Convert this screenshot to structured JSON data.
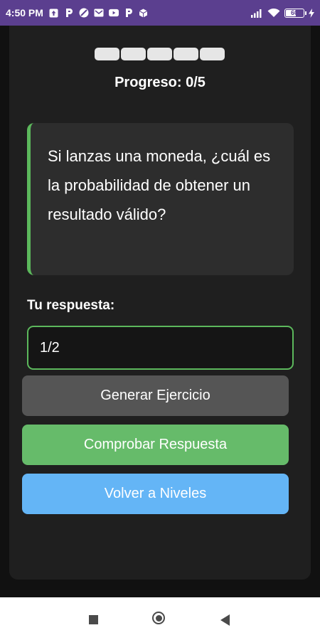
{
  "status_bar": {
    "time": "4:50 PM",
    "battery_level": "60",
    "battery_fraction": 0.6,
    "icons_left": [
      "upload-icon",
      "parking-icon",
      "blocked-icon",
      "mail-icon",
      "youtube-icon",
      "parking-icon",
      "package-icon"
    ],
    "icons_right": [
      "signal-icon",
      "wifi-icon",
      "battery-icon",
      "charging-icon"
    ],
    "color": "#5b3f8f"
  },
  "progress": {
    "label": "Progreso: 0/5",
    "completed": 0,
    "total": 5
  },
  "question": {
    "text": "Si lanzas una moneda, ¿cuál es la probabilidad de obtener un resultado válido?"
  },
  "answer": {
    "label": "Tu respuesta:",
    "value": "1/2"
  },
  "buttons": {
    "generate": "Generar Ejercicio",
    "check": "Comprobar Respuesta",
    "back": "Volver a Niveles"
  },
  "colors": {
    "accent_green": "#5cb85c",
    "check_button": "#66bb6a",
    "back_button": "#64b5f6",
    "generate_button": "#555555"
  },
  "nav_bar": {
    "icons": [
      "recents-icon",
      "home-icon",
      "back-icon"
    ]
  }
}
